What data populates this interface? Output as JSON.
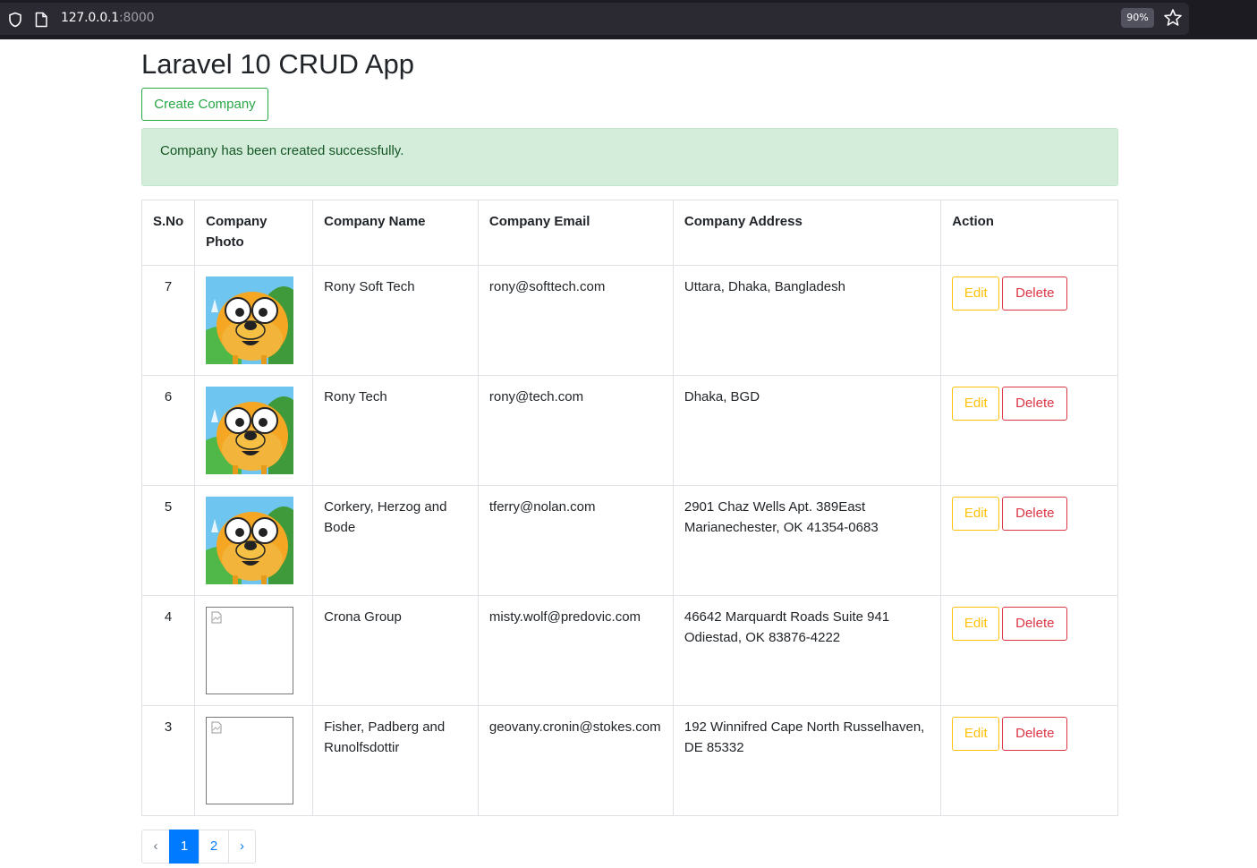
{
  "browser": {
    "url_host": "127.0.0.1",
    "url_port": ":8000",
    "zoom": "90%"
  },
  "page": {
    "title": "Laravel 10 CRUD App",
    "create_button": "Create Company",
    "alert": "Company has been created successfully."
  },
  "table": {
    "headers": [
      "S.No",
      "Company Photo",
      "Company Name",
      "Company Email",
      "Company Address",
      "Action"
    ],
    "rows": [
      {
        "sno": "7",
        "photo": "cartoon-dog-image",
        "name": "Rony Soft Tech",
        "email": "rony@softtech.com",
        "address": "Uttara, Dhaka, Bangladesh"
      },
      {
        "sno": "6",
        "photo": "cartoon-dog-image",
        "name": "Rony Tech",
        "email": "rony@tech.com",
        "address": "Dhaka, BGD"
      },
      {
        "sno": "5",
        "photo": "cartoon-dog-image",
        "name": "Corkery, Herzog and Bode",
        "email": "tferry@nolan.com",
        "address": "2901 Chaz Wells Apt. 389East Marianechester, OK 41354-0683"
      },
      {
        "sno": "4",
        "photo": "broken-image",
        "name": "Crona Group",
        "email": "misty.wolf@predovic.com",
        "address": "46642 Marquardt Roads Suite 941 Odiestad, OK 83876-4222"
      },
      {
        "sno": "3",
        "photo": "broken-image",
        "name": "Fisher, Padberg and Runolfsdottir",
        "email": "geovany.cronin@stokes.com",
        "address": "192 Winnifred Cape North Russelhaven, DE 85332"
      }
    ],
    "edit_label": "Edit",
    "delete_label": "Delete"
  },
  "pagination": {
    "prev": "‹",
    "pages": [
      "1",
      "2"
    ],
    "active": "1",
    "next": "›"
  },
  "colors": {
    "success": "#28a745",
    "warning": "#ffc107",
    "danger": "#dc3545",
    "primary": "#007bff",
    "alert_bg": "#d4edda"
  }
}
